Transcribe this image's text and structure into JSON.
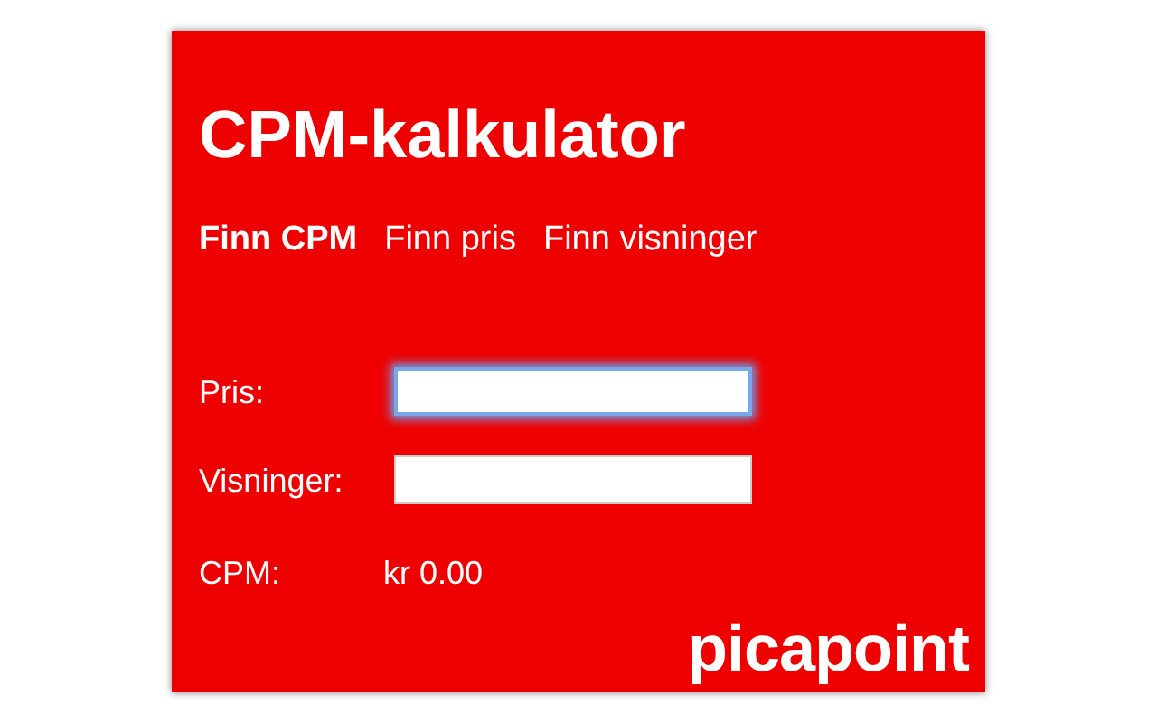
{
  "title": "CPM-kalkulator",
  "tabs": [
    {
      "label": "Finn CPM",
      "selected": true
    },
    {
      "label": "Finn pris",
      "selected": false
    },
    {
      "label": "Finn visninger",
      "selected": false
    }
  ],
  "fields": [
    {
      "label": "Pris:",
      "focused": true
    },
    {
      "label": "Visninger:",
      "focused": false
    }
  ],
  "result": {
    "label": "CPM:",
    "value": "kr 0.00"
  },
  "logo": "picapoint"
}
